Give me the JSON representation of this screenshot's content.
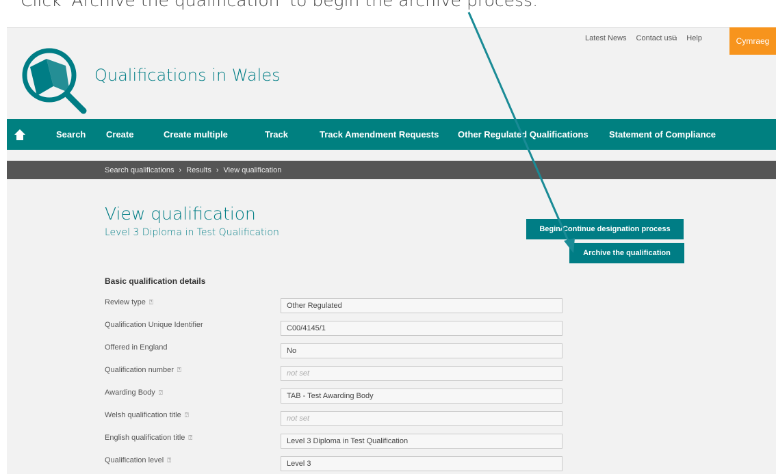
{
  "instruction": "Click 'Archive the qualification' to begin the archive process.",
  "top_links": {
    "latest_news": "Latest News",
    "contact_us": "Contact us",
    "contact_icon": "external-link-icon",
    "help": "Help",
    "language": "Cymraeg"
  },
  "colors": {
    "teal": "#007d85",
    "orange": "#f7941d",
    "breadcrumb_bg": "#555555"
  },
  "site": {
    "title": "Qualifications in Wales",
    "logo_icon": "magnifier-book-logo"
  },
  "nav": {
    "home_icon": "home-icon",
    "items": [
      {
        "label": "Search"
      },
      {
        "label": "Create"
      },
      {
        "label": "Create multiple"
      },
      {
        "label": "Track"
      },
      {
        "label": "Track Amendment Requests"
      },
      {
        "label": "Other Regulated Qualifications"
      },
      {
        "label": "Statement of Compliance"
      }
    ]
  },
  "breadcrumb": {
    "items": [
      "Search qualifications",
      "Results",
      "View qualification"
    ],
    "separator": "›"
  },
  "page": {
    "title": "View qualification",
    "subtitle": "Level 3 Diploma in Test Qualification",
    "designation_button": "Begin/Continue designation process",
    "archive_button": "Archive the qualification"
  },
  "details": {
    "heading": "Basic qualification details",
    "help_icon": "question-circle-icon",
    "rows": [
      {
        "label": "Review type",
        "value": "Other Regulated",
        "help": true
      },
      {
        "label": "Qualification Unique Identifier",
        "value": "C00/4145/1",
        "help": false
      },
      {
        "label": "Offered in England",
        "value": "No",
        "help": false
      },
      {
        "label": "Qualification number",
        "value": "not set",
        "help": true
      },
      {
        "label": "Awarding Body",
        "value": "TAB - Test Awarding Body",
        "help": true
      },
      {
        "label": "Welsh qualification title",
        "value": "not set",
        "help": true
      },
      {
        "label": "English qualification title",
        "value": "Level 3 Diploma in Test Qualification",
        "help": true
      },
      {
        "label": "Qualification level",
        "value": "Level 3",
        "help": true
      }
    ]
  }
}
